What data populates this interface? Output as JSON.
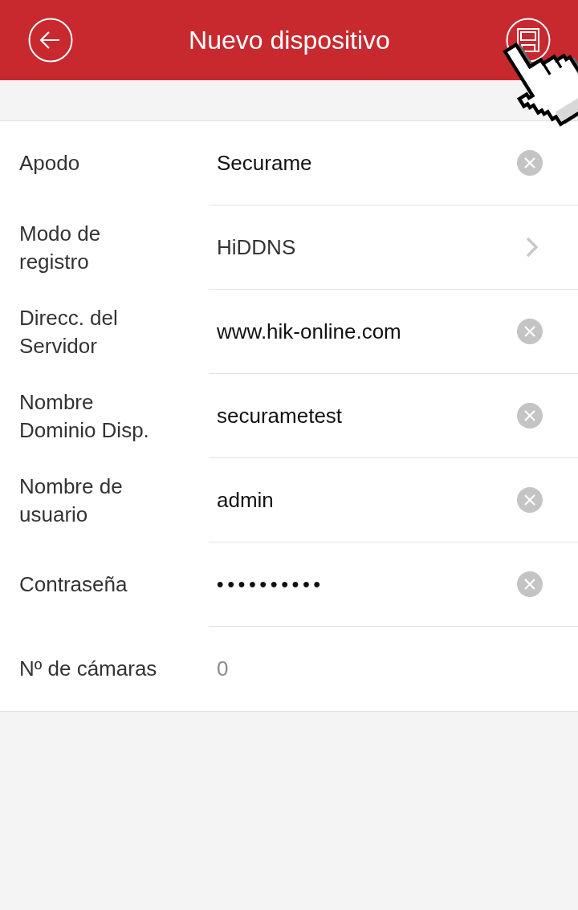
{
  "header": {
    "title": "Nuevo dispositivo"
  },
  "fields": [
    {
      "label": "Apodo",
      "kind": "input",
      "value": "Securame"
    },
    {
      "label": "Modo de\nregistro",
      "kind": "select",
      "value": "HiDDNS"
    },
    {
      "label": "Direcc. del\nServidor",
      "kind": "input",
      "value": "www.hik-online.com"
    },
    {
      "label": "Nombre\nDominio Disp.",
      "kind": "input",
      "value": "securametest"
    },
    {
      "label": "Nombre de\nusuario",
      "kind": "input",
      "value": "admin"
    },
    {
      "label": "Contraseña",
      "kind": "password",
      "value": "••••••••••"
    },
    {
      "label": "Nº de cámaras",
      "kind": "readonly",
      "value": "0"
    }
  ]
}
